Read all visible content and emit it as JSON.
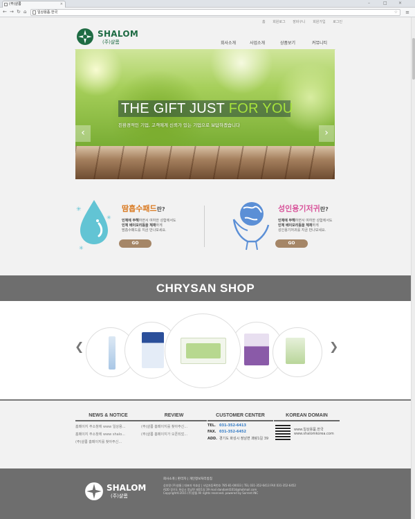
{
  "browser": {
    "tab_title": "(주)샬롬",
    "tab_close": "×",
    "url": "일상용품.한국",
    "back": "←",
    "forward": "→",
    "reload": "↻",
    "home": "⌂",
    "bookmark_star": "☆",
    "menu": "≡",
    "minimize": "–",
    "maximize": "□",
    "close": "×"
  },
  "utility_links": [
    "홈",
    "회원로그",
    "장바구니",
    "회원가입",
    "로그인"
  ],
  "logo": {
    "name": "SHALOM",
    "sub": "(주)샬롬",
    "color": "#1e6b43"
  },
  "nav": [
    "회사소개",
    "사업소개",
    "상품보기",
    "커뮤니티"
  ],
  "hero": {
    "headline_white": "THE GIFT JUST ",
    "headline_green": "FOR YOU",
    "subline": "친환경적인 기업, 고객에게 신뢰가 있는 기업으로 보답하겠습니다",
    "prev": "‹",
    "next": "›"
  },
  "promos": [
    {
      "title": "땀흡수패드",
      "title_color": "#d9781e",
      "suffix": "란?",
      "lines": [
        {
          "bold": "인체에 무해",
          "rest": "하면서 여하한 성함에서도"
        },
        {
          "bold": "인체 베이모리듬을 체재",
          "rest": "하게"
        },
        {
          "bold": "",
          "rest": "땀흡수패드를 지금 만나보세요."
        }
      ],
      "button": "GO"
    },
    {
      "title": "성인용기저귀",
      "title_color": "#d8539a",
      "suffix": "란?",
      "lines": [
        {
          "bold": "인체에 무해",
          "rest": "하면서 여하한 성함에서도"
        },
        {
          "bold": "인체 베이모리듬을 체재",
          "rest": "하게"
        },
        {
          "bold": "",
          "rest": "성인용기저귀를 지금 만나보세요."
        }
      ],
      "button": "GO"
    }
  ],
  "shop": {
    "title": "CHRYSAN SHOP",
    "prev": "❮",
    "next": "❯"
  },
  "news": {
    "heading": "NEWS & NOTICE",
    "items": [
      "홈페이지 주소창에 www 일상용...",
      "홈페이지 주소창에 www shalo...",
      "(주)샬롬 홈페이지를 찾아주신..."
    ]
  },
  "review": {
    "heading": "REVIEW",
    "items": [
      "(주)샬롬 홈페이지를 찾아주신...",
      "(주)샬롬 홈페이지가 오픈되었..."
    ]
  },
  "customer": {
    "heading": "CUSTOMER CENTER",
    "tel_label": "TEL.",
    "tel": "031-352-6413",
    "fax_label": "FAX.",
    "fax": "031-352-6452",
    "add_label": "ADD.",
    "address": "경기도 화성시 정남면 괘랑1길 39"
  },
  "domain": {
    "heading": "KOREAN DOMAIN",
    "line1": "www.일상용품.한국",
    "line2": "www.shalomkorea.com"
  },
  "footer": {
    "name": "SHALOM",
    "sub": "(주)샬롬",
    "links": "회사소개 | 판리자 | 개인정보처리방침",
    "addr1": "상호명 (주)샬롬 | 대표자 이효상 | 사업자등록번호 785-81-00033 | TEL 031-352-6413 FAX 031-352-6452",
    "addr2": "ADD 경기도 화성시 정남면 괘랑1길 39 mail dandamt1014@hotmail.com",
    "addr3": "Copyright©2015 (주)샬롬 All rights reserved. powered by Sorrent INC"
  }
}
